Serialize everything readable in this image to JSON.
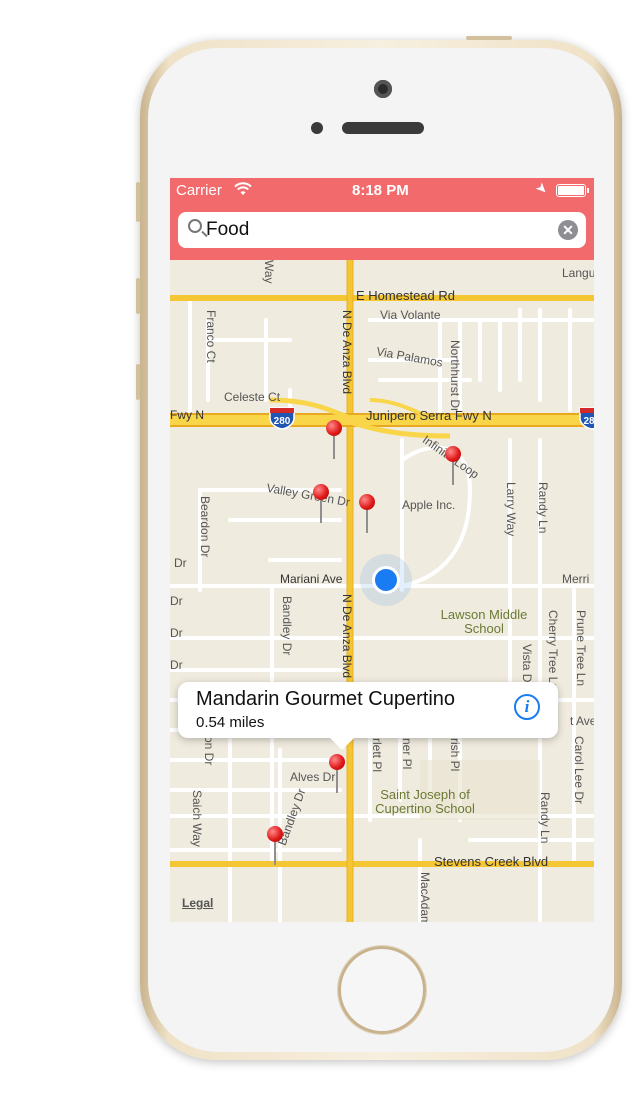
{
  "status_bar": {
    "carrier": "Carrier",
    "time": "8:18 PM"
  },
  "search": {
    "value": "Food"
  },
  "map": {
    "streets": {
      "homestead": "E Homestead Rd",
      "via_volante": "Via Volante",
      "via_palamos": "Via Palamos",
      "celeste": "Celeste Ct",
      "franco": "Franco Ct",
      "northhurst": "Northhurst Dr",
      "de_anza_top": "N De Anza Blvd",
      "de_anza_mid": "N De Anza Blvd",
      "junipero": "Junipero Serra Fwy N",
      "fwy_left": "Fwy N",
      "infinite_loop": "Infinite Loop",
      "valley_green": "Valley Green Dr",
      "apple": "Apple Inc.",
      "larry": "Larry Way",
      "randy_top": "Randy Ln",
      "beardon": "Beardon Dr",
      "mariani": "Mariani Ave",
      "merri": "Merri",
      "bandley_mid": "Bandley Dr",
      "cherry_tree": "Cherry Tree Ln",
      "prune_tree": "Prune Tree Ln",
      "vista": "Vista Dr",
      "alves": "Alves Dr",
      "saich": "Saich Way",
      "bandley_low": "Bandley Dr",
      "stevens_creek": "Stevens Creek Blvd",
      "macadam": "MacAdam",
      "randy_low": "Randy Ln",
      "carol_lee": "Carol Lee Dr",
      "langu": "Langu",
      "way": "Way",
      "dr1": "Dr",
      "dr2": "Dr",
      "dr3": "Dr",
      "dr4": "Dr",
      "street_ave": "t Ave",
      "on_dr": "on Dr",
      "rlett": "rlett Pl",
      "ner": "ner Pl",
      "rish": "rish Pl"
    },
    "schools": {
      "lawson": "Lawson Middle School",
      "saint_joseph": "Saint Joseph of Cupertino School"
    },
    "shields": {
      "i280_a": "280",
      "i280_b": "28"
    },
    "legal": "Legal"
  },
  "callout": {
    "title": "Mandarin Gourmet Cupertino",
    "distance": "0.54 miles"
  },
  "icons": {
    "search": "search-icon",
    "clear": "clear-icon",
    "info": "info-icon",
    "pin": "map-pin-icon",
    "wifi": "wifi-icon",
    "location": "location-arrow-icon",
    "battery": "battery-icon"
  },
  "colors": {
    "accent": "#f36a6d",
    "map_bg": "#f0ebdf",
    "highway": "#f5c634",
    "user_dot": "#1a7cf2",
    "pin": "#e01b1b"
  }
}
